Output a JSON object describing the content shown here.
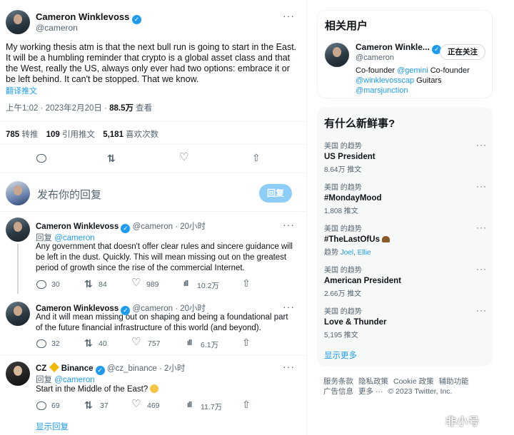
{
  "main_tweet": {
    "name": "Cameron Winklevoss",
    "handle": "@cameron",
    "text": "My working thesis atm is that the next bull run is going to start in the East. It will be a humbling reminder that crypto is a global asset class and that the West, really the US, always only ever had two options: embrace it or be left behind. It can't be stopped. That we know.",
    "translate_label": "翻译推文",
    "time": "上午1:02 · 2023年2月20日 · ",
    "views_count": "88.5万",
    "views_label": " 查看",
    "retweets_count": "785",
    "retweets_label": " 转推",
    "quotes_count": "109",
    "quotes_label": " 引用推文",
    "likes_count": "5,181",
    "likes_label": " 喜欢次数"
  },
  "compose": {
    "placeholder": "发布你的回复",
    "button_label": "回复"
  },
  "replies": [
    {
      "name": "Cameron Winklevoss",
      "handle_time": "@cameron · 20小时",
      "reply_to_prefix": "回复 ",
      "reply_to": "@cameron",
      "text": "Any government that doesn't offer clear rules and sincere guidance will be left in the dust. Quickly. This will mean missing out on the greatest period of growth since the rise of the commercial Internet.",
      "replies": "30",
      "retweets": "84",
      "likes": "989",
      "views": "10.2万"
    },
    {
      "name": "Cameron Winklevoss",
      "handle_time": "@cameron · 20小时",
      "text": "And it will mean missing out on shaping and being a foundational part of the future financial infrastructure of this world (and beyond).",
      "replies": "32",
      "retweets": "40",
      "likes": "757",
      "views": "6.1万"
    },
    {
      "name_a": "CZ",
      "name_b": "Binance",
      "handle_time": "@cz_binance · 2小时",
      "reply_to_prefix": "回复 ",
      "reply_to": "@cameron",
      "text": "Start in the Middle of the East?",
      "replies": "69",
      "retweets": "37",
      "likes": "469",
      "views": "11.7万"
    }
  ],
  "show_replies": "显示回复",
  "sidebar": {
    "related_title": "相关用户",
    "related_user": {
      "name": "Cameron Winkle...",
      "handle": "@cameron",
      "follow_label": "正在关注",
      "bio_1": "Co-founder ",
      "bio_link1": "@gemini",
      "bio_2": " Co-founder",
      "bio_link2": "@winklevosscap",
      "bio_3": " Guitars",
      "bio_link3": "@marsjunction"
    },
    "trends_title": "有什么新鲜事?",
    "trends": [
      {
        "category": "美国 的趋势",
        "name": "US President",
        "count": "8.64万 推文"
      },
      {
        "category": "美国 的趋势",
        "name": "#MondayMood",
        "count": "1,808 推文"
      },
      {
        "category": "美国 的趋势",
        "name": "#TheLastOfUs",
        "count_prefix": "趋势 ",
        "count_link1": "Joel",
        "count_sep": ", ",
        "count_link2": "Ellie"
      },
      {
        "category": "美国 的趋势",
        "name": "American President",
        "count": "2.66万 推文"
      },
      {
        "category": "美国 的趋势",
        "name": "Love & Thunder",
        "count": "5,195 推文"
      }
    ],
    "show_more": "显示更多",
    "footer": [
      "服务条款",
      "隐私政策",
      "Cookie 政策",
      "辅助功能",
      "广告信息",
      "更多 ···",
      "© 2023 Twitter, Inc."
    ]
  },
  "watermark": "非小号",
  "icons": {
    "verified": "verified-badge-icon",
    "accent": "#1d9bf0"
  }
}
